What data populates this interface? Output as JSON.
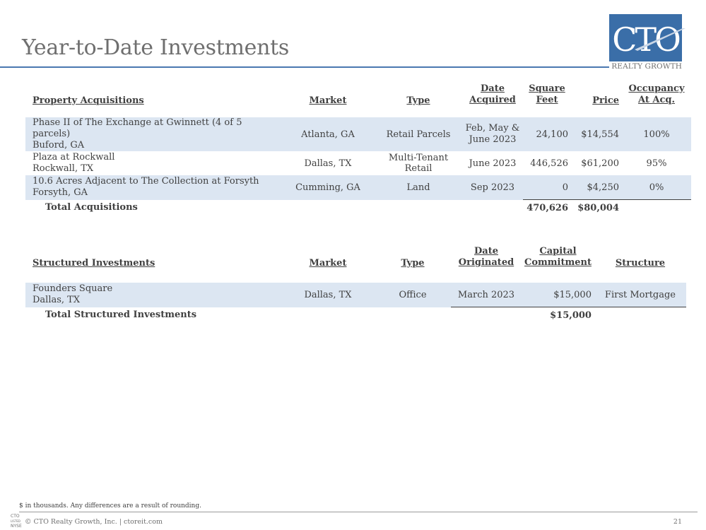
{
  "page": {
    "title": "Year-to-Date Investments",
    "page_number": "21",
    "footnote": "$ in thousands. Any differences are a result of rounding.",
    "copyright": "© CTO Realty Growth, Inc. | ctoreit.com"
  },
  "logo": {
    "mark": "CTO",
    "subtitle": "REALTY GROWTH",
    "footer_top": "CTO",
    "footer_mid": "LISTED",
    "footer_bottom": "NYSE",
    "brand_color": "#3a6ea8"
  },
  "acquisitions": {
    "headers": {
      "property": "Property Acquisitions",
      "market": "Market",
      "type": "Type",
      "date_line1": "Date",
      "date_line2": "Acquired",
      "sqft_line1": "Square",
      "sqft_line2": "Feet",
      "price": "Price",
      "occ_line1": "Occupancy",
      "occ_line2": "At Acq."
    },
    "rows": [
      {
        "name": "Phase II of The Exchange at Gwinnett (4 of 5 parcels)",
        "location": "Buford, GA",
        "market": "Atlanta, GA",
        "type": "Retail Parcels",
        "date_line1": "Feb, May &",
        "date_line2": "June 2023",
        "sqft": "24,100",
        "price": "$14,554",
        "occupancy": "100%"
      },
      {
        "name": "Plaza at Rockwall",
        "location": "Rockwall, TX",
        "market": "Dallas, TX",
        "type": "Multi-Tenant Retail",
        "date_line1": "June 2023",
        "date_line2": "",
        "sqft": "446,526",
        "price": "$61,200",
        "occupancy": "95%"
      },
      {
        "name": "10.6 Acres Adjacent to The Collection at Forsyth",
        "location": "Forsyth, GA",
        "market": "Cumming, GA",
        "type": "Land",
        "date_line1": "Sep 2023",
        "date_line2": "",
        "sqft": "0",
        "price": "$4,250",
        "occupancy": "0%"
      }
    ],
    "total": {
      "label": "Total Acquisitions",
      "sqft": "470,626",
      "price": "$80,004"
    }
  },
  "structured": {
    "headers": {
      "investment": "Structured Investments",
      "market": "Market",
      "type": "Type",
      "date_line1": "Date",
      "date_line2": "Originated",
      "cap_line1": "Capital",
      "cap_line2": "Commitment",
      "structure": "Structure"
    },
    "rows": [
      {
        "name": "Founders Square",
        "location": "Dallas, TX",
        "market": "Dallas, TX",
        "type": "Office",
        "date": "March 2023",
        "commitment": "$15,000",
        "structure": "First Mortgage"
      }
    ],
    "total": {
      "label": "Total Structured Investments",
      "commitment": "$15,000"
    }
  }
}
